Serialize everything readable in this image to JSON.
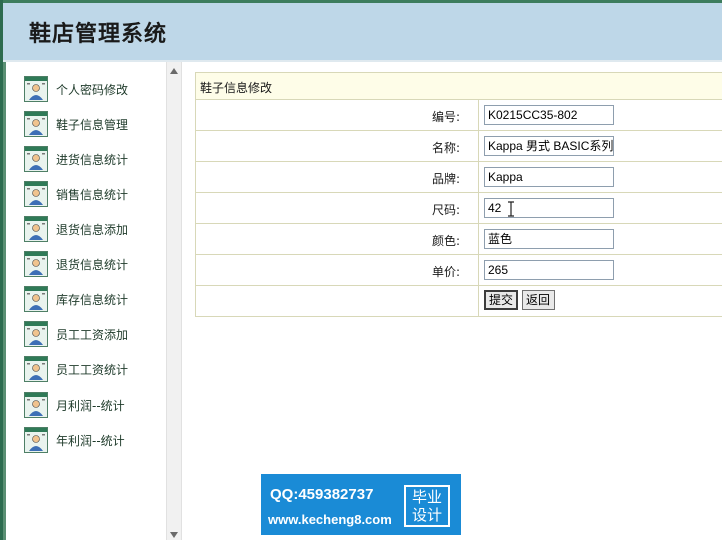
{
  "header": {
    "title": "鞋店管理系统"
  },
  "sidebar": {
    "items": [
      {
        "label": "个人密码修改"
      },
      {
        "label": "鞋子信息管理"
      },
      {
        "label": "进货信息统计"
      },
      {
        "label": "销售信息统计"
      },
      {
        "label": "退货信息添加"
      },
      {
        "label": "退货信息统计"
      },
      {
        "label": "库存信息统计"
      },
      {
        "label": "员工工资添加"
      },
      {
        "label": "员工工资统计"
      },
      {
        "label": "月利润--统计"
      },
      {
        "label": "年利润--统计"
      }
    ]
  },
  "form": {
    "title": "鞋子信息修改",
    "fields": [
      {
        "label": "编号:",
        "value": "K0215CC35-802"
      },
      {
        "label": "名称:",
        "value": "Kappa 男式 BASIC系列"
      },
      {
        "label": "品牌:",
        "value": "Kappa"
      },
      {
        "label": "尺码:",
        "value": "42"
      },
      {
        "label": "颜色:",
        "value": "蓝色"
      },
      {
        "label": "单价:",
        "value": "265"
      }
    ],
    "submit_label": "提交",
    "back_label": "返回"
  },
  "watermark": {
    "qq": "QQ:459382737",
    "site": "www.kecheng8.com",
    "badge_line1": "毕业",
    "badge_line2": "设计"
  },
  "colors": {
    "header_bg": "#bed7e8",
    "form_title_bg": "#fefde8",
    "watermark_bg": "#1a8bd6"
  },
  "icons": {
    "sidebar_item_icon": "user-card-icon",
    "scroll_up": "triangle-up-icon",
    "scroll_down": "triangle-down-icon",
    "text_cursor": "i-beam-cursor-icon"
  }
}
